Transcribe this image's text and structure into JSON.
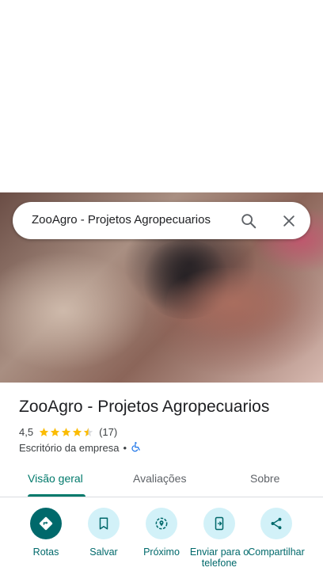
{
  "search": {
    "query": "ZooAgro - Projetos Agropecuarios"
  },
  "place": {
    "title": "ZooAgro - Projetos Agropecuarios",
    "rating": "4,5",
    "review_count": "(17)",
    "category": "Escritório da empresa",
    "separator": "•"
  },
  "tabs": [
    {
      "label": "Visão geral"
    },
    {
      "label": "Avaliações"
    },
    {
      "label": "Sobre"
    }
  ],
  "actions": [
    {
      "label": "Rotas",
      "icon": "directions-icon"
    },
    {
      "label": "Salvar",
      "icon": "bookmark-icon"
    },
    {
      "label": "Próximo",
      "icon": "nearby-icon"
    },
    {
      "label": "Enviar para o telefone",
      "icon": "send-to-phone-icon"
    },
    {
      "label": "Compartilhar",
      "icon": "share-icon"
    }
  ],
  "colors": {
    "accent": "#00796b",
    "star": "#fbbc04",
    "action_bg": "#d2f1f8",
    "accessibility": "#1a73e8"
  }
}
